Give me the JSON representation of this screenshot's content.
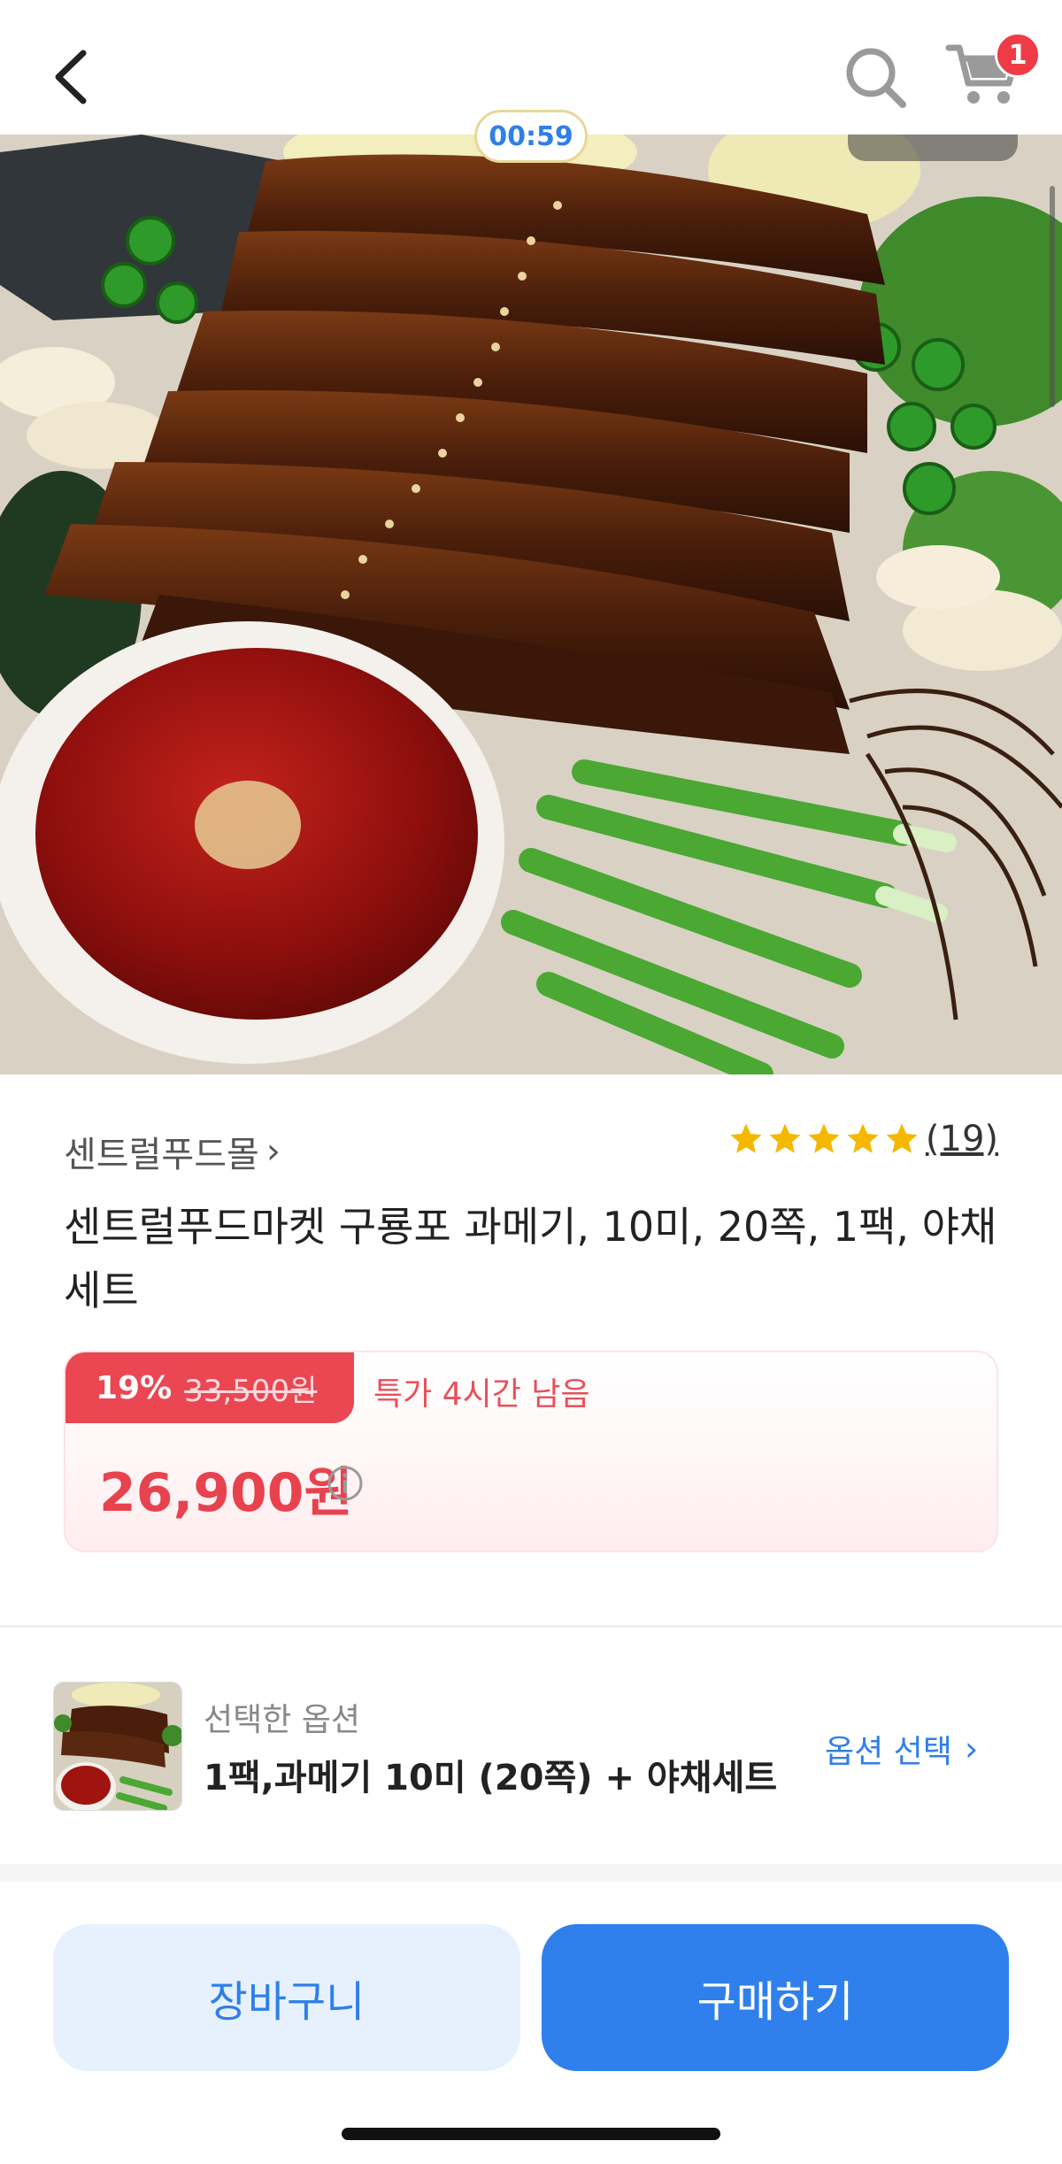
{
  "header": {
    "back_icon": "chevron-left-icon",
    "search_icon": "search-icon",
    "cart_icon": "cart-icon",
    "cart_badge": "1"
  },
  "hero": {
    "timer": "00:59"
  },
  "product": {
    "seller": "센트럴푸드몰",
    "rating_count": "(19)",
    "rating_stars": 5,
    "title": "센트럴푸드마켓 구룡포 과메기, 10미, 20쪽, 1팩, 야채세트"
  },
  "price": {
    "discount": "19%",
    "original": "33,500원",
    "special": "특가 4시간 남음",
    "final": "26,900원"
  },
  "option": {
    "label": "선택한 옵션",
    "value": "1팩,과메기 10미 (20쪽) + 야채세트",
    "select": "옵션 선택"
  },
  "actions": {
    "cart": "장바구니",
    "buy": "구매하기"
  },
  "colors": {
    "accent_blue": "#2f80ed",
    "sale_red": "#ea4753",
    "star": "#f5b800"
  }
}
